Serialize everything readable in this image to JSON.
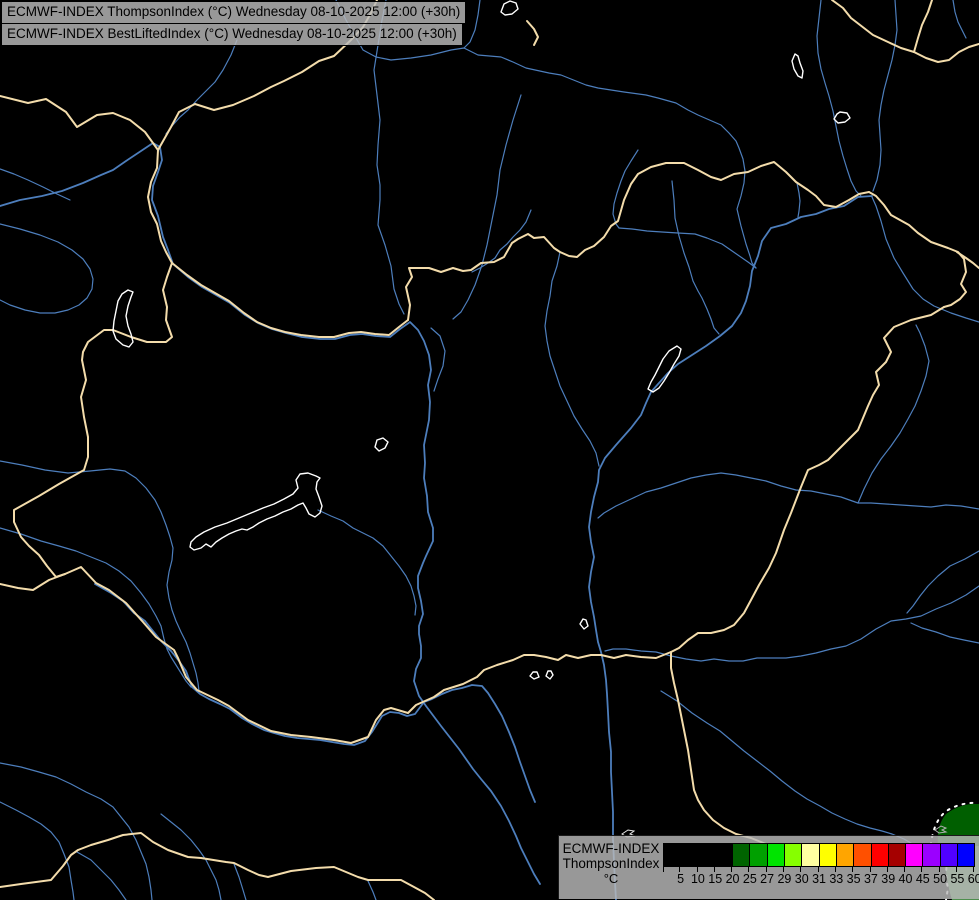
{
  "header": {
    "line1": "ECMWF-INDEX ThompsonIndex (°C) Wednesday 08-10-2025 12:00 (+30h)",
    "line2": "ECMWF-INDEX BestLiftedIndex (°C) Wednesday 08-10-2025 12:00 (+30h)"
  },
  "legend": {
    "product": "ECMWF-INDEX",
    "index_name": "ThompsonIndex",
    "unit": "°C",
    "stops": [
      {
        "label": "5",
        "color": "#000000"
      },
      {
        "label": "10",
        "color": "#000000"
      },
      {
        "label": "15",
        "color": "#000000"
      },
      {
        "label": "20",
        "color": "#000000"
      },
      {
        "label": "25",
        "color": "#006400"
      },
      {
        "label": "27",
        "color": "#00a000"
      },
      {
        "label": "29",
        "color": "#00e400"
      },
      {
        "label": "30",
        "color": "#86ff00"
      },
      {
        "label": "31",
        "color": "#ffffa0"
      },
      {
        "label": "33",
        "color": "#ffff00"
      },
      {
        "label": "35",
        "color": "#ffa500"
      },
      {
        "label": "37",
        "color": "#ff5000"
      },
      {
        "label": "39",
        "color": "#ff0000"
      },
      {
        "label": "40",
        "color": "#a50000"
      },
      {
        "label": "45",
        "color": "#ff00ff"
      },
      {
        "label": "50",
        "color": "#9b00ff"
      },
      {
        "label": "55",
        "color": "#5000ff"
      },
      {
        "label": "60",
        "color": "#0000ff"
      }
    ]
  },
  "map": {
    "colors": {
      "background": "#000000",
      "country_border": "#f3dcab",
      "river": "#4d7ebc",
      "lake_outline": "#ffffff",
      "index_area_green": "#005f00",
      "panel_gray": "#b9b9b9"
    }
  }
}
